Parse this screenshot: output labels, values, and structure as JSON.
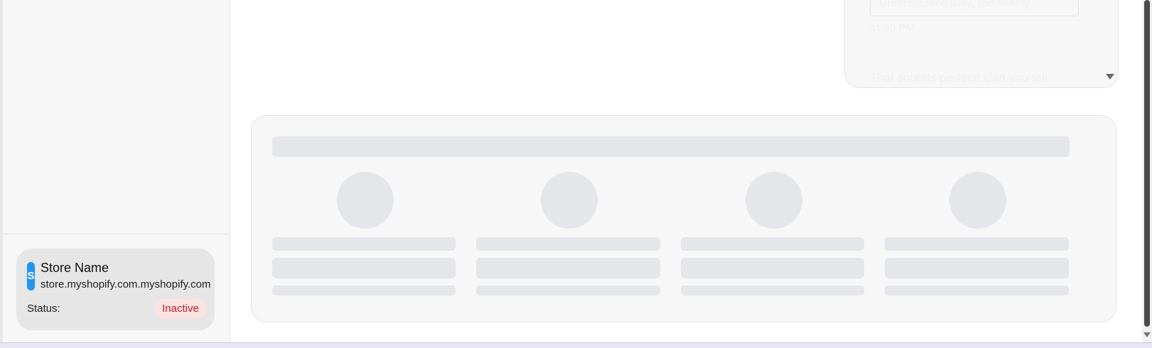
{
  "sidebar": {
    "store": {
      "avatar_letter": "S",
      "name": "Store Name",
      "url": "store.myshopify.com.myshopify.com",
      "status_label": "Status:",
      "status_value": "Inactive",
      "status_color": "#b4232a",
      "avatar_color": "#2196f3"
    }
  },
  "chat": {
    "quoted_text": "Great sound quality, and battery",
    "time": "11:39 PM",
    "reply_text": "That sounds perfect! Can you tell"
  },
  "loading_placeholder": {
    "columns": 4
  }
}
